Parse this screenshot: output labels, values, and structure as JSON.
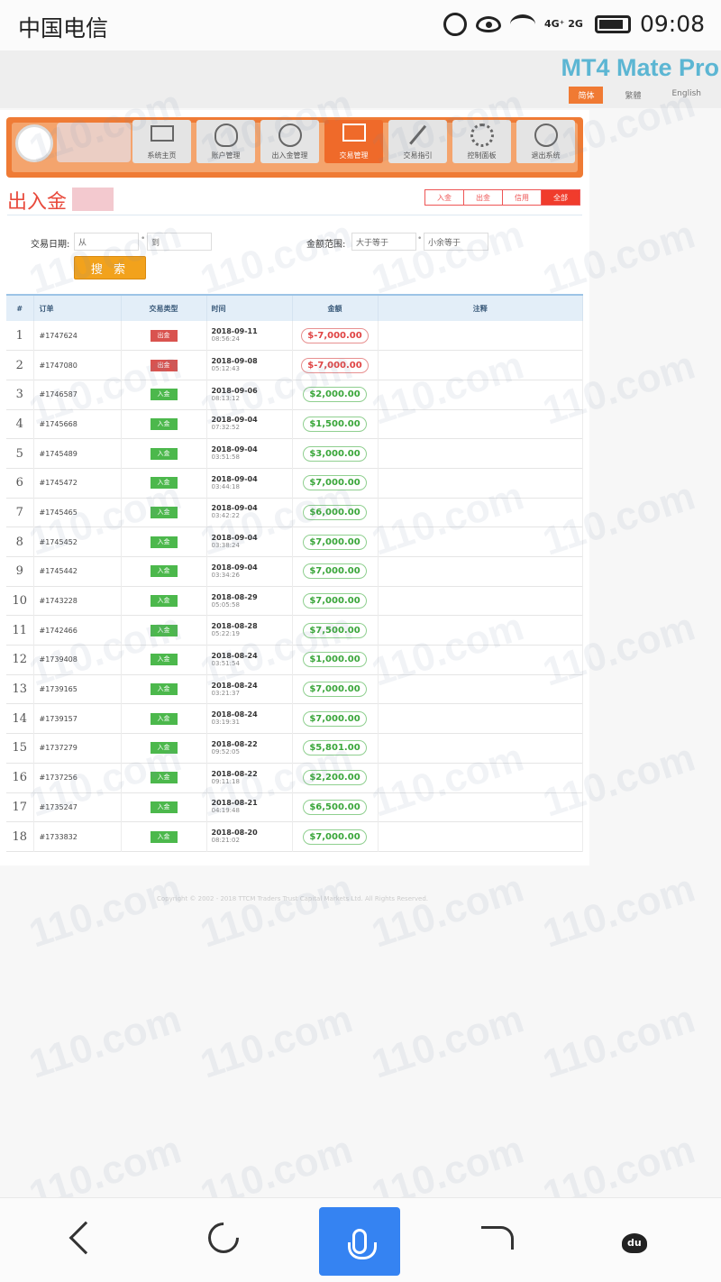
{
  "status_bar": {
    "carrier": "中国电信",
    "network": "4G⁺ 2G",
    "time": "09:08"
  },
  "header": {
    "brand": "MT4 Mate Pro",
    "languages": [
      "简体",
      "繁體",
      "English"
    ],
    "active_language": "简体"
  },
  "nav": {
    "items": [
      {
        "label": "系统主页",
        "icon": "monitor-icon"
      },
      {
        "label": "账户管理",
        "icon": "user-icon"
      },
      {
        "label": "出入金管理",
        "icon": "compass-icon"
      },
      {
        "label": "交易管理",
        "icon": "chart-icon"
      },
      {
        "label": "交易指引",
        "icon": "tools-icon"
      },
      {
        "label": "控制面板",
        "icon": "gear-icon"
      },
      {
        "label": "退出系统",
        "icon": "exit-icon"
      }
    ],
    "active": "交易管理"
  },
  "page_title": "出入金",
  "filter_tabs": [
    "入金",
    "出金",
    "信用",
    "全部"
  ],
  "active_filter": "全部",
  "search": {
    "date_label": "交易日期:",
    "date_from": "从",
    "date_to": "到",
    "amount_label": "金额范围:",
    "amount_min": "大于等于",
    "amount_max": "小余等于",
    "button": "搜 索"
  },
  "table": {
    "headers": [
      "#",
      "订单",
      "交易类型",
      "时间",
      "金额",
      "注释"
    ],
    "rows": [
      {
        "n": "1",
        "order": "#1747624",
        "type": "出金",
        "dir": "out",
        "date": "2018-09-11",
        "time": "08:56:24",
        "amount": "$-7,000.00"
      },
      {
        "n": "2",
        "order": "#1747080",
        "type": "出金",
        "dir": "out",
        "date": "2018-09-08",
        "time": "05:12:43",
        "amount": "$-7,000.00"
      },
      {
        "n": "3",
        "order": "#1746587",
        "type": "入金",
        "dir": "in",
        "date": "2018-09-06",
        "time": "08:13:12",
        "amount": "$2,000.00"
      },
      {
        "n": "4",
        "order": "#1745668",
        "type": "入金",
        "dir": "in",
        "date": "2018-09-04",
        "time": "07:32:52",
        "amount": "$1,500.00"
      },
      {
        "n": "5",
        "order": "#1745489",
        "type": "入金",
        "dir": "in",
        "date": "2018-09-04",
        "time": "03:51:58",
        "amount": "$3,000.00"
      },
      {
        "n": "6",
        "order": "#1745472",
        "type": "入金",
        "dir": "in",
        "date": "2018-09-04",
        "time": "03:44:18",
        "amount": "$7,000.00"
      },
      {
        "n": "7",
        "order": "#1745465",
        "type": "入金",
        "dir": "in",
        "date": "2018-09-04",
        "time": "03:42:22",
        "amount": "$6,000.00"
      },
      {
        "n": "8",
        "order": "#1745452",
        "type": "入金",
        "dir": "in",
        "date": "2018-09-04",
        "time": "03:38:24",
        "amount": "$7,000.00"
      },
      {
        "n": "9",
        "order": "#1745442",
        "type": "入金",
        "dir": "in",
        "date": "2018-09-04",
        "time": "03:34:26",
        "amount": "$7,000.00"
      },
      {
        "n": "10",
        "order": "#1743228",
        "type": "入金",
        "dir": "in",
        "date": "2018-08-29",
        "time": "05:05:58",
        "amount": "$7,000.00"
      },
      {
        "n": "11",
        "order": "#1742466",
        "type": "入金",
        "dir": "in",
        "date": "2018-08-28",
        "time": "05:22:19",
        "amount": "$7,500.00"
      },
      {
        "n": "12",
        "order": "#1739408",
        "type": "入金",
        "dir": "in",
        "date": "2018-08-24",
        "time": "03:51:54",
        "amount": "$1,000.00"
      },
      {
        "n": "13",
        "order": "#1739165",
        "type": "入金",
        "dir": "in",
        "date": "2018-08-24",
        "time": "03:21:37",
        "amount": "$7,000.00"
      },
      {
        "n": "14",
        "order": "#1739157",
        "type": "入金",
        "dir": "in",
        "date": "2018-08-24",
        "time": "03:19:31",
        "amount": "$7,000.00"
      },
      {
        "n": "15",
        "order": "#1737279",
        "type": "入金",
        "dir": "in",
        "date": "2018-08-22",
        "time": "09:52:05",
        "amount": "$5,801.00"
      },
      {
        "n": "16",
        "order": "#1737256",
        "type": "入金",
        "dir": "in",
        "date": "2018-08-22",
        "time": "09:11:18",
        "amount": "$2,200.00"
      },
      {
        "n": "17",
        "order": "#1735247",
        "type": "入金",
        "dir": "in",
        "date": "2018-08-21",
        "time": "04:19:48",
        "amount": "$6,500.00"
      },
      {
        "n": "18",
        "order": "#1733832",
        "type": "入金",
        "dir": "in",
        "date": "2018-08-20",
        "time": "08:21:02",
        "amount": "$7,000.00"
      }
    ]
  },
  "footer": {
    "copyright": "Copyright © 2002 - 2018 TTCM Traders Trust Capital Markets Ltd. All Rights Reserved."
  },
  "watermark_text": "110.com",
  "colors": {
    "accent": "#ef7b35",
    "brand": "#5cb6d3",
    "title_red": "#e84a3c",
    "deposit_green": "#4cb84c",
    "withdraw_red": "#d9534f",
    "browser_mic": "#3583f2"
  },
  "bottom_nav": {
    "icons": [
      "back-icon",
      "reload-icon",
      "mic-icon",
      "share-icon",
      "baidu-paw-icon"
    ]
  }
}
